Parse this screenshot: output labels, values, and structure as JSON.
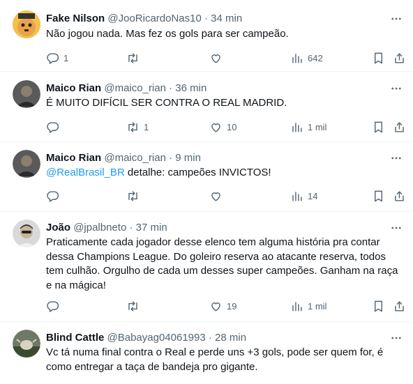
{
  "tweets": [
    {
      "name": "Fake Nilson",
      "handle": "@JooRicardoNas10",
      "time": "· 34 min",
      "text": "Não jogou nada. Mas fez os gols para ser campeão.",
      "replies": "1",
      "retweets": "",
      "likes": "",
      "views": "642"
    },
    {
      "name": "Maico Rian",
      "handle": "@maico_rian",
      "time": "· 36 min",
      "text": "É MUITO DIFÍCIL SER CONTRA O REAL MADRID.",
      "replies": "",
      "retweets": "1",
      "likes": "10",
      "views": "1 mil"
    },
    {
      "name": "Maico Rian",
      "handle": "@maico_rian",
      "time": "· 9 min",
      "mention": "@RealBrasil_BR",
      "text": " detalhe: campeões INVICTOS!",
      "replies": "",
      "retweets": "",
      "likes": "",
      "views": "14"
    },
    {
      "name": "João",
      "handle": "@jpalbneto",
      "time": "· 37 min",
      "text": "Praticamente cada jogador desse elenco tem alguma história pra contar dessa Champions League. Do goleiro reserva ao atacante reserva, todos tem culhão. Orgulho de cada um desses super campeões. Ganham na raça e na mágica!",
      "replies": "",
      "retweets": "",
      "likes": "19",
      "views": "1 mil"
    },
    {
      "name": "Blind Cattle",
      "handle": "@Babayag04061993",
      "time": "· 28 min",
      "text": "Vc tá numa final contra o Real e perde uns +3 gols, pode ser quem for, é como entregar a taça de bandeja pro gigante."
    }
  ],
  "icons": {
    "reply": "reply-icon",
    "retweet": "retweet-icon",
    "like": "heart-icon",
    "views": "views-icon",
    "bookmark": "bookmark-icon",
    "share": "share-icon",
    "more": "more-icon"
  },
  "colors": {
    "text": "#0f1419",
    "secondary": "#536471",
    "link": "#1d9bf0",
    "divider": "#eff3f4"
  }
}
